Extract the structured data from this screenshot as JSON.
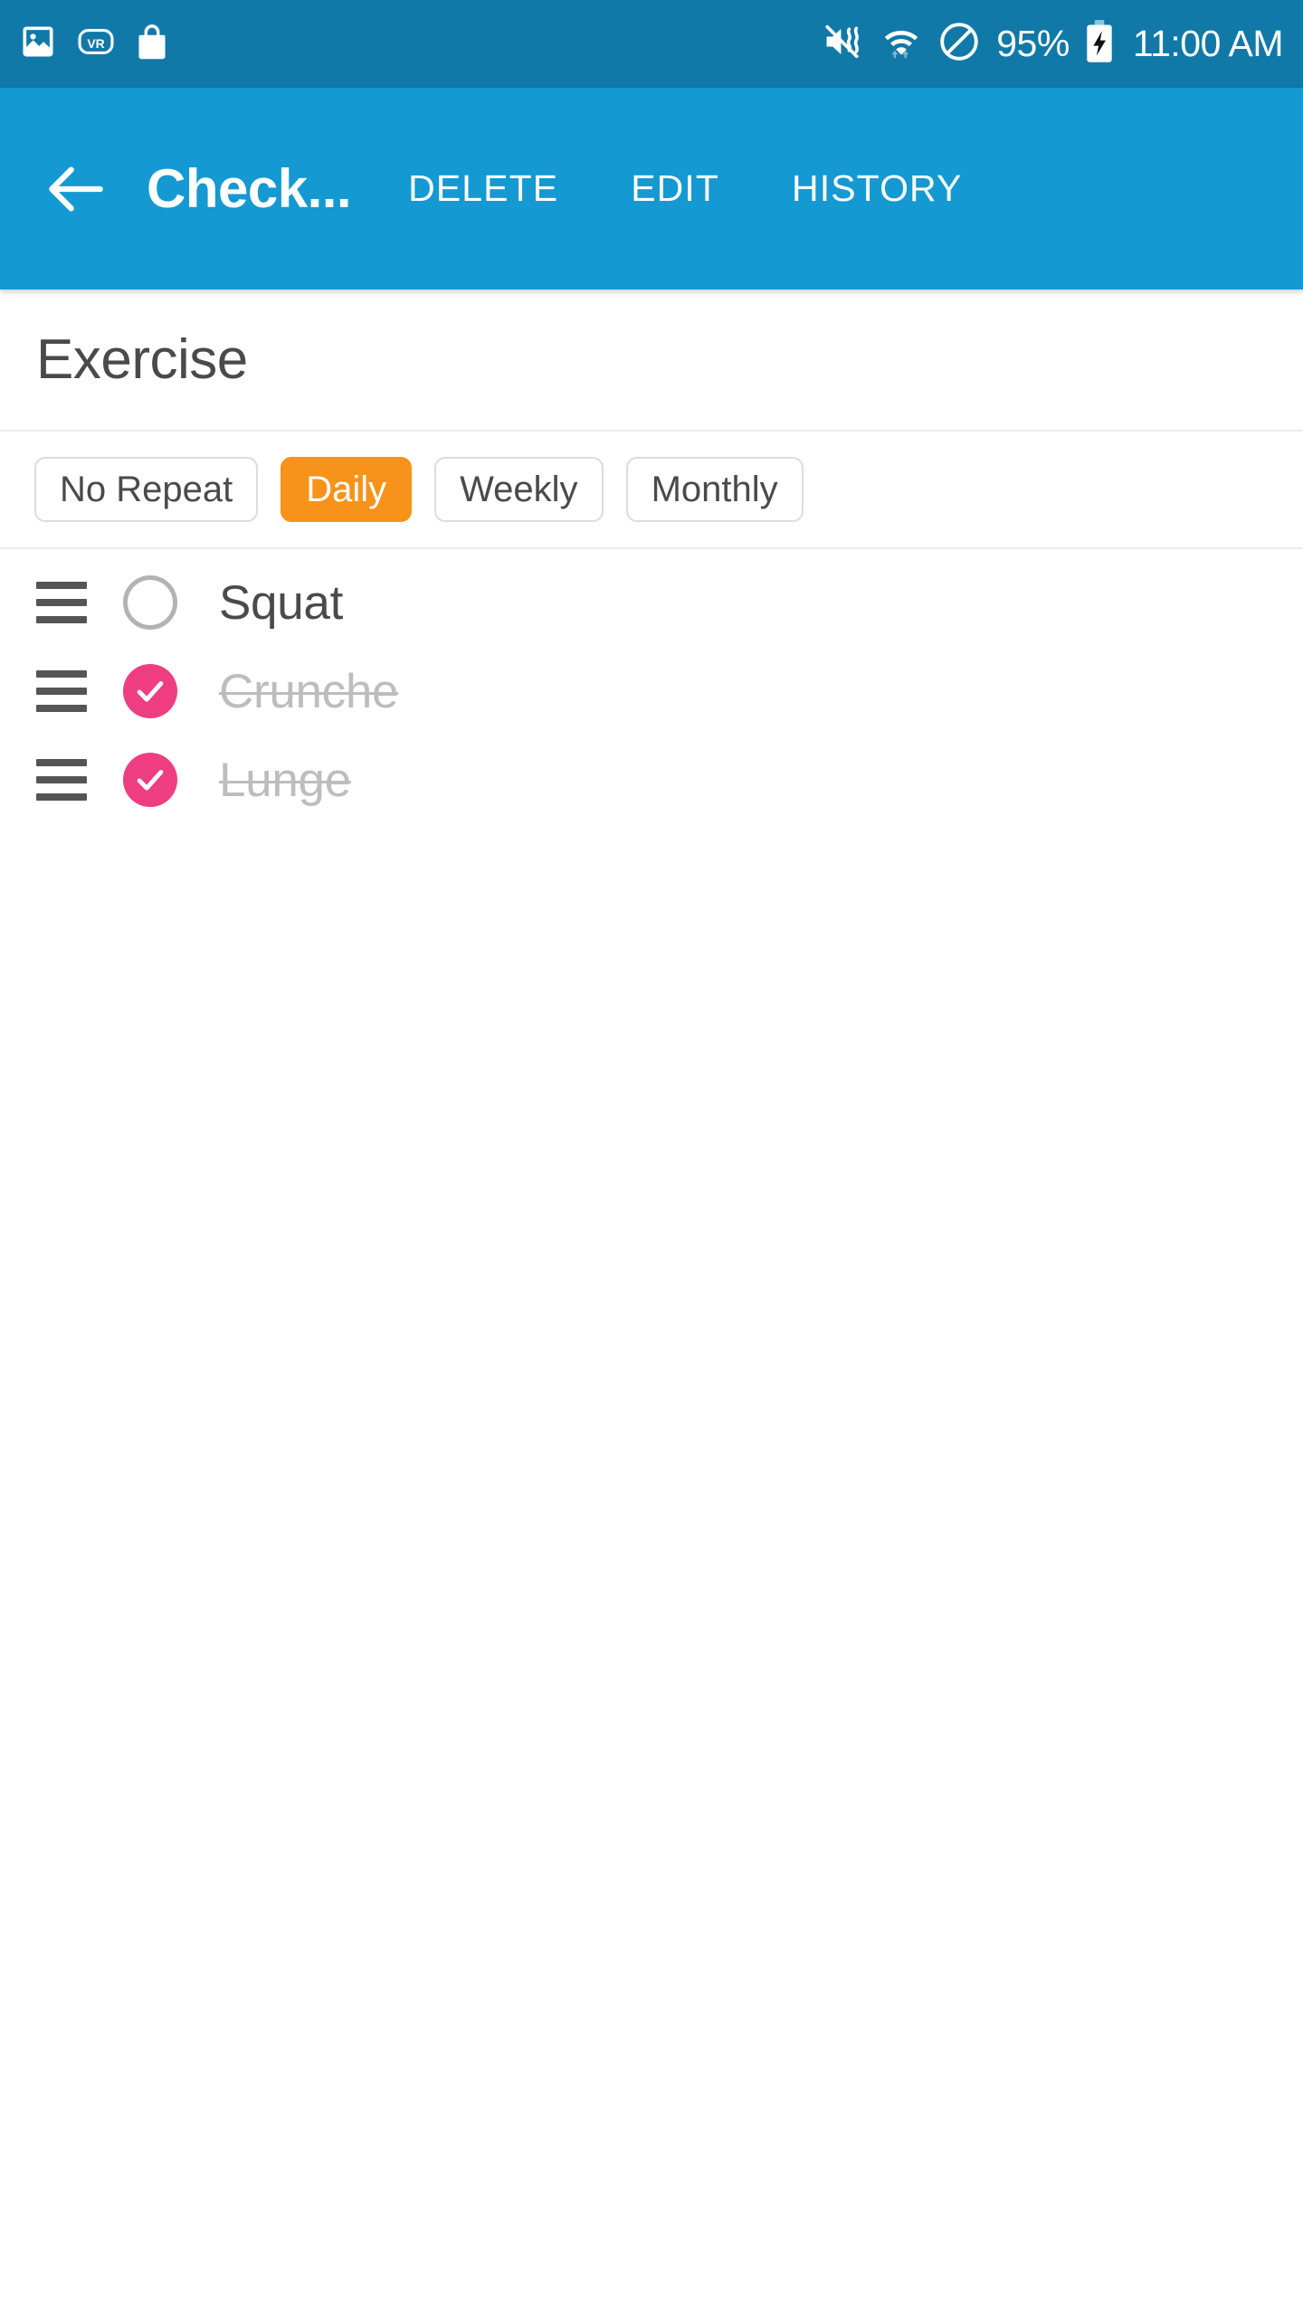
{
  "status_bar": {
    "background_color": "#1179A8",
    "left_icons": [
      {
        "name": "image-icon",
        "label": "image"
      },
      {
        "name": "vr-icon",
        "label": "VR"
      },
      {
        "name": "shopping-bag-icon",
        "label": "shopping bag"
      }
    ],
    "right_icons": [
      {
        "name": "mute-vibrate-icon",
        "label": "sound off / vibrate"
      },
      {
        "name": "wifi-icon",
        "label": "wifi"
      },
      {
        "name": "do-not-disturb-icon",
        "label": "do not disturb"
      }
    ],
    "battery_percent": "95%",
    "battery_charging": true,
    "clock": "11:00 AM"
  },
  "app_bar": {
    "background_color": "#1499D3",
    "back_label": "back",
    "title": "Check...",
    "actions": [
      {
        "name": "delete",
        "label": "DELETE"
      },
      {
        "name": "edit",
        "label": "EDIT"
      },
      {
        "name": "history",
        "label": "HISTORY"
      }
    ]
  },
  "section": {
    "title": "Exercise"
  },
  "repeat_chips": {
    "selected_color": "#F7931A",
    "selected": "Daily",
    "options": [
      {
        "label": "No Repeat",
        "selected": false
      },
      {
        "label": "Daily",
        "selected": true
      },
      {
        "label": "Weekly",
        "selected": false
      },
      {
        "label": "Monthly",
        "selected": false
      }
    ]
  },
  "checklist": {
    "checked_color": "#EF3D82",
    "items": [
      {
        "label": "Squat",
        "checked": false
      },
      {
        "label": "Crunche",
        "checked": true
      },
      {
        "label": "Lunge",
        "checked": true
      }
    ]
  }
}
